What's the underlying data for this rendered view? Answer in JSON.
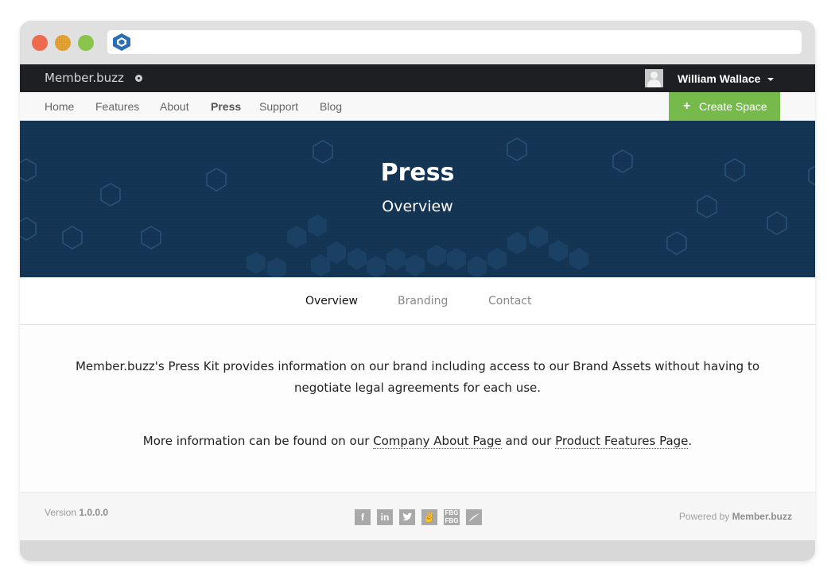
{
  "browser": {
    "window_controls": [
      "close",
      "minimize",
      "maximize"
    ],
    "url_icon": "memberbuzz-hexagon-logo"
  },
  "topbar": {
    "brand": "Member.buzz",
    "user_name": "William Wallace"
  },
  "nav": {
    "items": [
      {
        "label": "Home"
      },
      {
        "label": "Features"
      },
      {
        "label": "About"
      },
      {
        "label": "Press",
        "active": true
      },
      {
        "label": "Support"
      },
      {
        "label": "Blog"
      }
    ],
    "create_button": "Create Space"
  },
  "hero": {
    "title": "Press",
    "subtitle": "Overview"
  },
  "tabs": [
    {
      "label": "Overview",
      "active": true
    },
    {
      "label": "Branding"
    },
    {
      "label": "Contact"
    }
  ],
  "content": {
    "para1_line1": "Member.buzz's Press Kit provides information on our brand including access to our Brand Assets without having to",
    "para1_line2": "negotiate legal agreements for each use.",
    "para2_prefix": "More information can be found on our ",
    "link_about": "Company About Page",
    "para2_middle": " and our ",
    "link_features": "Product Features Page",
    "para2_suffix": "."
  },
  "footer": {
    "version_label": "Version",
    "version_number": "1.0.0.0",
    "powered_label": "Powered by",
    "powered_brand": "Member.buzz",
    "social_icons": [
      "facebook-icon",
      "linkedin-icon",
      "twitter-icon",
      "angellist-icon",
      "foursquare-icon",
      "feather-icon"
    ]
  },
  "colors": {
    "topbar": "#1d1f22",
    "hero": "#133453",
    "create_button": "#76ba4c"
  }
}
